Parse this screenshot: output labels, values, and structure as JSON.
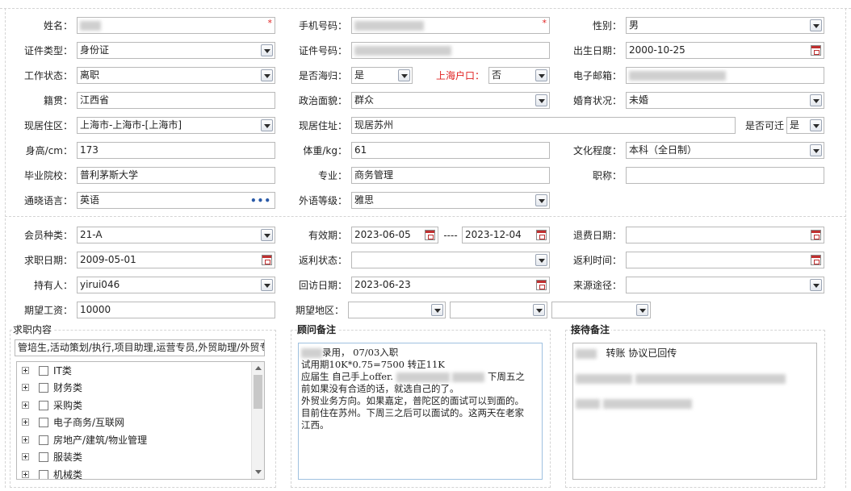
{
  "row1": {
    "name_label": "姓名：",
    "required_mark": "*",
    "phone_label": "手机号码：",
    "gender_label": "性别：",
    "gender": "男"
  },
  "row2": {
    "idtype_label": "证件类型：",
    "idtype": "身份证",
    "idno_label": "证件号码：",
    "birth_label": "出生日期：",
    "birth": "2000-10-25"
  },
  "row3": {
    "workstatus_label": "工作状态：",
    "workstatus": "离职",
    "returnee_label": "是否海归：",
    "returnee": "是",
    "hukou_label": "上海户口：",
    "hukou": "否",
    "email_label": "电子邮箱："
  },
  "row4": {
    "native_label": "籍贯：",
    "native": "江西省",
    "politics_label": "政治面貌：",
    "politics": "群众",
    "marital_label": "婚育状况：",
    "marital": "未婚"
  },
  "row5": {
    "region_label": "现居住区：",
    "region": "上海市-上海市-[上海市]",
    "address_label": "现居住址：",
    "address": "现居苏州",
    "relocate_label": "是否可迁",
    "relocate": "是"
  },
  "row6": {
    "height_label": "身高/cm：",
    "height": "173",
    "weight_label": "体重/kg：",
    "weight": "61",
    "education_label": "文化程度：",
    "education": "本科（全日制）"
  },
  "row7": {
    "school_label": "毕业院校：",
    "school": "普利茅斯大学",
    "major_label": "专业：",
    "major": "商务管理",
    "title_label": "职称：",
    "title": ""
  },
  "row8": {
    "language_label": "通晓语言：",
    "language": "英语",
    "more": "•••",
    "langlevel_label": "外语等级：",
    "langlevel": "雅思"
  },
  "row9": {
    "membertype_label": "会员种类：",
    "membertype": "21-A",
    "valid_label": "有效期：",
    "valid_from": "2023-06-05",
    "valid_sep": "----",
    "valid_to": "2023-12-04",
    "refund_date_label": "退费日期：",
    "refund_date": ""
  },
  "row10": {
    "jobdate_label": "求职日期：",
    "jobdate": "2009-05-01",
    "rebate_status_label": "返利状态：",
    "rebate_status": "",
    "rebate_time_label": "返利时间：",
    "rebate_time": ""
  },
  "row11": {
    "holder_label": "持有人：",
    "holder": "yirui046",
    "visit_label": "回访日期：",
    "visit": "2023-06-23",
    "source_label": "来源途径：",
    "source": ""
  },
  "row12": {
    "salary_label": "期望工资：",
    "salary": "10000",
    "area_label": "期望地区："
  },
  "job": {
    "title": "求职内容",
    "summary": "管培生,活动策划/执行,项目助理,运营专员,外贸助理/外贸专员",
    "tree": [
      "IT类",
      "财务类",
      "采购类",
      "电子商务/互联网",
      "房地产/建筑/物业管理",
      "服装类",
      "机械类"
    ]
  },
  "advisor": {
    "title": "顾问备注",
    "lines": [
      "录用， 07/03入职",
      "试用期10K*0.75=7500   转正11K",
      "",
      "应届生 自己手上offer.",
      "前如果没有合适的话，就选自己的了。",
      "外贸业务方向。如果嘉定，普陀区的面试可以到面的。",
      "目前住在苏州。下周三之后可以面试的。这两天在老家",
      "江西。"
    ],
    "tail_text": "下周五之"
  },
  "reception": {
    "title": "接待备注",
    "line1": "转账    协议已回传"
  }
}
